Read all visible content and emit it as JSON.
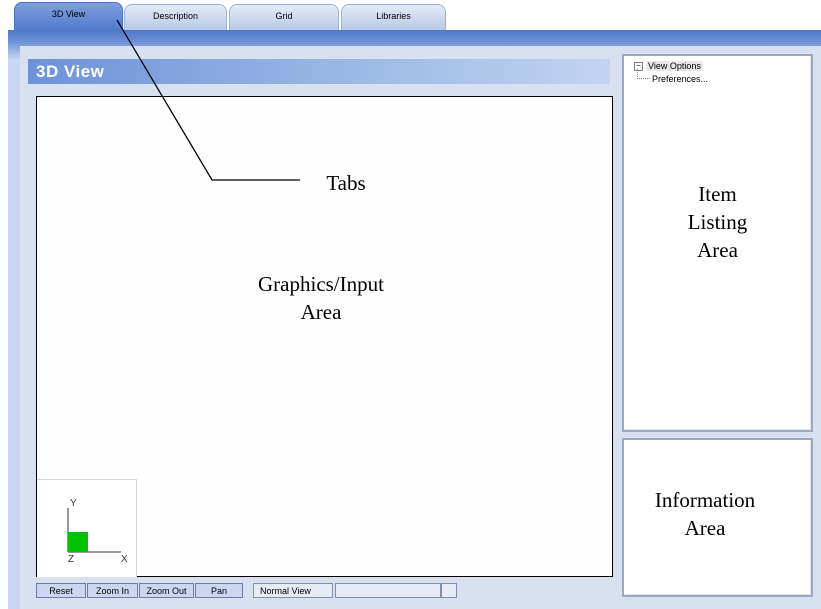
{
  "tabs": [
    {
      "label": "3D View",
      "active": true
    },
    {
      "label": "Description",
      "active": false
    },
    {
      "label": "Grid",
      "active": false
    },
    {
      "label": "Libraries",
      "active": false
    }
  ],
  "view": {
    "title": "3D View",
    "graphics_label_line1": "Graphics/Input",
    "graphics_label_line2": "Area",
    "tabs_callout": "Tabs",
    "axes": {
      "y": "Y",
      "x": "X",
      "z": "Z",
      "z_color": "#00c000"
    }
  },
  "toolbar": {
    "reset": "Reset",
    "zoom_in": "Zoom In",
    "zoom_out": "Zoom Out",
    "pan": "Pan",
    "status": "Normal View"
  },
  "item_panel": {
    "tree_root": "View Options",
    "tree_child": "Preferences...",
    "label_line1": "Item",
    "label_line2": "Listing",
    "label_line3": "Area"
  },
  "info_panel": {
    "label_line1": "Information",
    "label_line2": "Area"
  },
  "colors": {
    "accent": "#4f78c8",
    "frame": "#c9d8f0"
  }
}
